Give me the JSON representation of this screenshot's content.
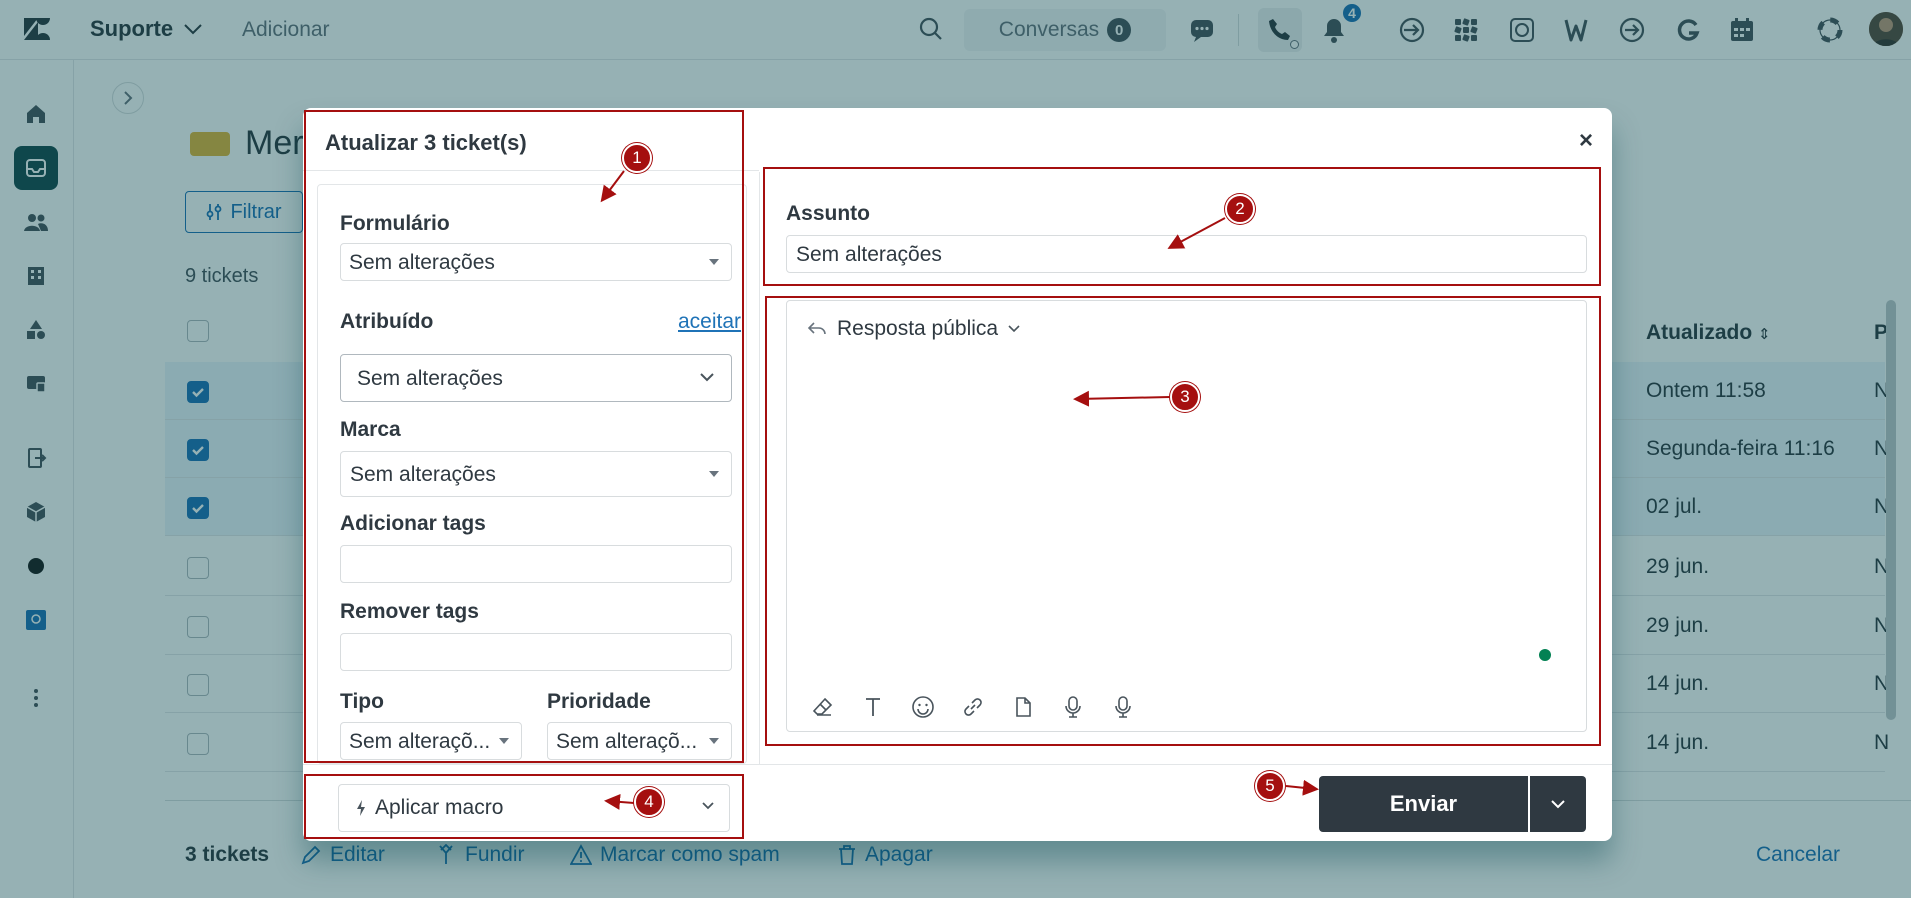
{
  "topbar": {
    "workspace": "Suporte",
    "add_label": "Adicionar",
    "conversations_label": "Conversas",
    "conversations_count": "0",
    "notifications_count": "4"
  },
  "view": {
    "title_partial": "Mer",
    "filter_label": "Filtrar",
    "ticket_count": "9 tickets",
    "col_updated": "Atualizado",
    "col_p": "P"
  },
  "rows": [
    {
      "updated": "Ontem 11:58",
      "p": "N",
      "selected": true
    },
    {
      "updated": "Segunda-feira 11:16",
      "p": "N",
      "selected": true
    },
    {
      "updated": "02 jul.",
      "p": "N",
      "selected": true
    },
    {
      "updated": "29 jun.",
      "p": "N",
      "selected": false
    },
    {
      "updated": "29 jun.",
      "p": "N",
      "selected": false
    },
    {
      "updated": "14 jun.",
      "p": "N",
      "selected": false
    },
    {
      "updated": "14 jun.",
      "p": "N",
      "selected": false
    }
  ],
  "bulkbar": {
    "count": "3 tickets",
    "edit": "Editar",
    "merge": "Fundir",
    "spam": "Marcar como spam",
    "delete": "Apagar",
    "cancel": "Cancelar"
  },
  "modal": {
    "title": "Atualizar 3 ticket(s)",
    "close": "×",
    "form_label": "Formulário",
    "form_value": "Sem alterações",
    "assignee_label": "Atribuído",
    "assignee_accept": "aceitar",
    "assignee_value": "Sem alterações",
    "brand_label": "Marca",
    "brand_value": "Sem alterações",
    "add_tags_label": "Adicionar tags",
    "remove_tags_label": "Remover tags",
    "type_label": "Tipo",
    "type_value": "Sem alteraçõ...",
    "priority_label": "Prioridade",
    "priority_value": "Sem alteraçõ...",
    "subject_label": "Assunto",
    "subject_value": "Sem alterações",
    "reply_type": "Resposta pública",
    "macro_label": "Aplicar macro",
    "send_label": "Enviar"
  },
  "annotations": [
    "1",
    "2",
    "3",
    "4",
    "5"
  ],
  "colors": {
    "annotation": "#a50f0f",
    "accent": "#1f73b7",
    "primary_button": "#2f3941",
    "sidebar_active": "#17494d"
  }
}
